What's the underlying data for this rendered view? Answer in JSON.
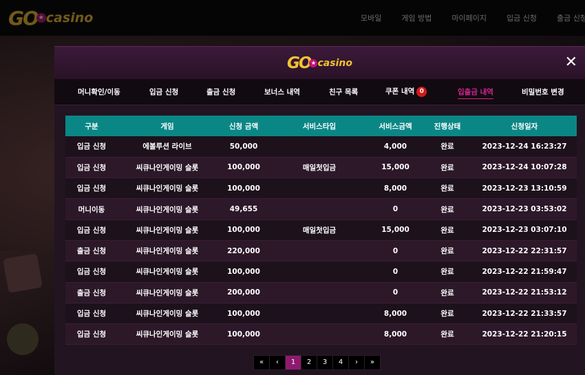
{
  "site": {
    "logo_go": "GO",
    "logo_casino": "casino",
    "nav": [
      "모바일",
      "게임 방법",
      "마이페이지",
      "입금 신청",
      "출금 신청"
    ]
  },
  "modal": {
    "logo_go": "GO",
    "logo_casino": "casino",
    "close_label": "✕",
    "tabs": [
      {
        "label": "머니확인/이동"
      },
      {
        "label": "입금 신청"
      },
      {
        "label": "출금 신청"
      },
      {
        "label": "보너스 내역"
      },
      {
        "label": "친구 목록"
      },
      {
        "label": "쿠폰 내역",
        "badge": "0"
      },
      {
        "label": "입출금 내역",
        "active": true
      },
      {
        "label": "비밀번호 변경"
      }
    ],
    "table": {
      "headers": [
        "구분",
        "게임",
        "신청 금액",
        "서비스타입",
        "서비스금액",
        "진행상태",
        "신청일자"
      ],
      "rows": [
        [
          "입금 신청",
          "에볼루션 라이브",
          "50,000",
          "",
          "4,000",
          "완료",
          "2023-12-24 16:23:27"
        ],
        [
          "입금 신청",
          "씨큐나인게이밍 슬롯",
          "100,000",
          "매일첫입금",
          "15,000",
          "완료",
          "2023-12-24 10:07:28"
        ],
        [
          "입금 신청",
          "씨큐나인게이밍 슬롯",
          "100,000",
          "",
          "8,000",
          "완료",
          "2023-12-23 13:10:59"
        ],
        [
          "머니이동",
          "씨큐나인게이밍 슬롯",
          "49,655",
          "",
          "0",
          "완료",
          "2023-12-23 03:53:02"
        ],
        [
          "입금 신청",
          "씨큐나인게이밍 슬롯",
          "100,000",
          "매일첫입금",
          "15,000",
          "완료",
          "2023-12-23 03:07:10"
        ],
        [
          "출금 신청",
          "씨큐나인게이밍 슬롯",
          "220,000",
          "",
          "0",
          "완료",
          "2023-12-22 22:31:57"
        ],
        [
          "입금 신청",
          "씨큐나인게이밍 슬롯",
          "100,000",
          "",
          "0",
          "완료",
          "2023-12-22 21:59:47"
        ],
        [
          "출금 신청",
          "씨큐나인게이밍 슬롯",
          "200,000",
          "",
          "0",
          "완료",
          "2023-12-22 21:53:12"
        ],
        [
          "입금 신청",
          "씨큐나인게이밍 슬롯",
          "100,000",
          "",
          "8,000",
          "완료",
          "2023-12-22 21:33:57"
        ],
        [
          "입금 신청",
          "씨큐나인게이밍 슬롯",
          "100,000",
          "",
          "8,000",
          "완료",
          "2023-12-22 21:20:15"
        ]
      ]
    },
    "pagination": {
      "first": "«",
      "prev": "‹",
      "pages": [
        "1",
        "2",
        "3",
        "4"
      ],
      "current": "1",
      "next": "›",
      "last": "»"
    }
  },
  "colors": {
    "accent": "#d2278e",
    "table_header": "#0a8785",
    "logo": "#f2c230",
    "active_page": "#8e1a6e"
  }
}
